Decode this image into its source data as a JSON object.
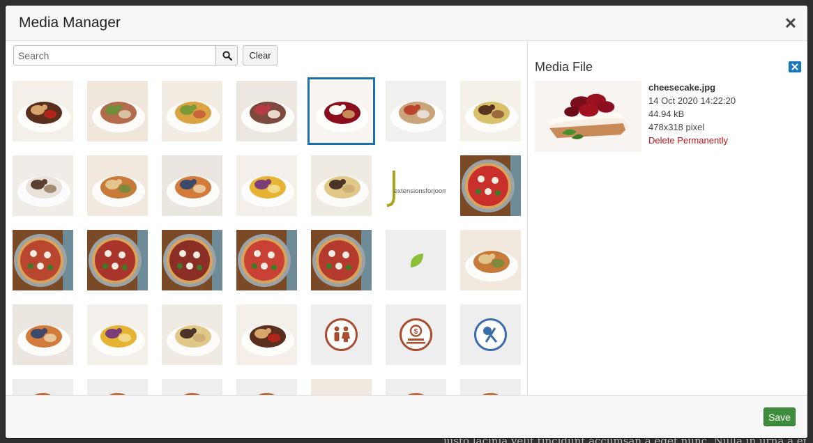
{
  "background_text": "justo lacinia velit tincidunt accumsan a eget nunc. Nulla in urna a enim",
  "modal": {
    "title": "Media Manager",
    "close_icon": "close-icon",
    "footer": {
      "save_label": "Save",
      "save_color": "#3d8d3d"
    }
  },
  "search": {
    "placeholder": "Search",
    "value": "",
    "button_icon": "search-icon",
    "clear_label": "Clear"
  },
  "grid": {
    "items": [
      {
        "name": "thumb-chocolate-cake",
        "image": "food-photo"
      },
      {
        "name": "thumb-rolled-roast",
        "image": "food-photo"
      },
      {
        "name": "thumb-tortellini",
        "image": "food-photo"
      },
      {
        "name": "thumb-raspberry-cake",
        "image": "food-photo"
      },
      {
        "name": "thumb-cheesecake",
        "image": "food-photo",
        "selected": true
      },
      {
        "name": "thumb-layer-dessert",
        "image": "food-photo"
      },
      {
        "name": "thumb-potato-salad",
        "image": "food-photo"
      },
      {
        "name": "thumb-rice-dish",
        "image": "food-photo"
      },
      {
        "name": "thumb-wraps",
        "image": "food-photo"
      },
      {
        "name": "thumb-seafood-pasta",
        "image": "food-photo"
      },
      {
        "name": "thumb-risotto-bowl",
        "image": "food-photo"
      },
      {
        "name": "thumb-fettuccine",
        "image": "food-photo"
      },
      {
        "name": "thumb-extensions-logo",
        "image": "logo",
        "logo_text": "extensionsforjoomla"
      },
      {
        "name": "thumb-pizza-1",
        "image": "food-photo"
      },
      {
        "name": "thumb-pizza-2",
        "image": "food-photo"
      },
      {
        "name": "thumb-pizza-3",
        "image": "food-photo"
      },
      {
        "name": "thumb-pizza-4",
        "image": "food-photo"
      },
      {
        "name": "thumb-pizza-5",
        "image": "food-photo"
      },
      {
        "name": "thumb-pizza-6",
        "image": "food-photo"
      },
      {
        "name": "thumb-leaf-icon",
        "image": "leaf-icon"
      },
      {
        "name": "thumb-sushi-rolls",
        "image": "food-photo"
      },
      {
        "name": "thumb-fish-plate",
        "image": "food-photo"
      },
      {
        "name": "thumb-fried-vegetables",
        "image": "food-photo"
      },
      {
        "name": "thumb-fried-balls",
        "image": "food-photo"
      },
      {
        "name": "thumb-bruschetta",
        "image": "food-photo"
      },
      {
        "name": "thumb-family-icon",
        "image": "family-icon"
      },
      {
        "name": "thumb-price-icon",
        "image": "price-icon"
      },
      {
        "name": "thumb-cooking-icon",
        "image": "cooking-icon"
      },
      {
        "name": "thumb-row5-1",
        "image": "round-icon"
      },
      {
        "name": "thumb-row5-2",
        "image": "round-icon"
      },
      {
        "name": "thumb-row5-3",
        "image": "round-icon"
      },
      {
        "name": "thumb-row5-4",
        "image": "round-icon"
      },
      {
        "name": "thumb-row5-5",
        "image": "food-photo"
      },
      {
        "name": "thumb-row5-6",
        "image": "round-icon"
      },
      {
        "name": "thumb-row5-7",
        "image": "round-icon"
      }
    ]
  },
  "file_panel": {
    "title": "Media File",
    "close_icon": "close-icon",
    "filename": "cheesecake.jpg",
    "date": "14 Oct 2020 14:22:20",
    "size": "44.94 kB",
    "dimensions": "478x318 pixel",
    "delete_label": "Delete Permanently",
    "delete_color": "#c0131a",
    "accent_color": "#1976b8"
  }
}
